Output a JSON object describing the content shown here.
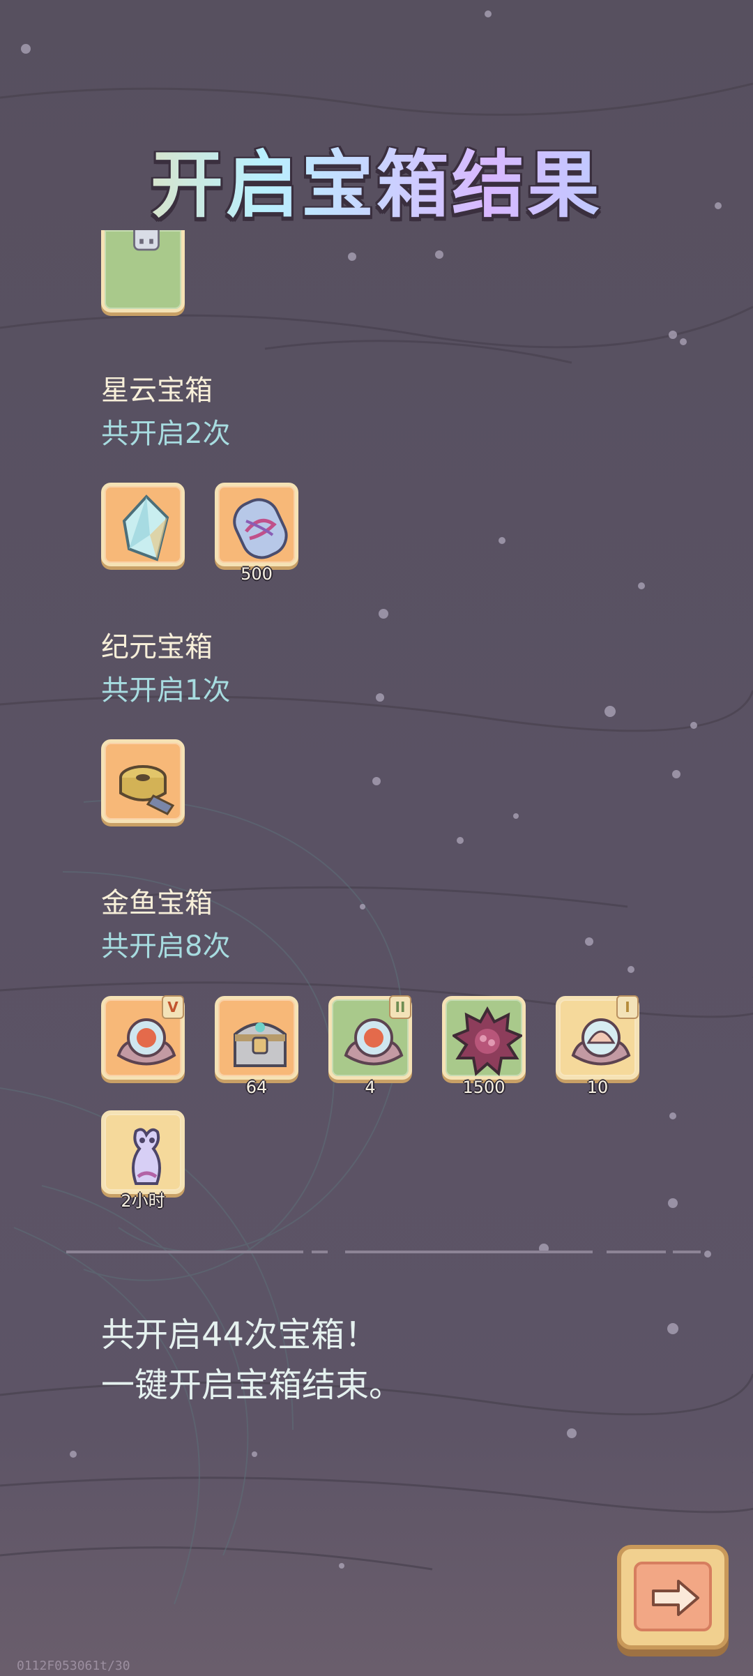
{
  "title": "开启宝箱结果",
  "sections": [
    {
      "name": "星云宝箱",
      "count": "共开启2次",
      "items": [
        {
          "icon": "crystal-shard-icon",
          "qty": "",
          "badge": ""
        },
        {
          "icon": "nebula-capsule-icon",
          "qty": "500",
          "badge": ""
        }
      ]
    },
    {
      "name": "纪元宝箱",
      "count": "共开启1次",
      "items": [
        {
          "icon": "film-reel-icon",
          "qty": "",
          "badge": ""
        }
      ]
    },
    {
      "name": "金鱼宝箱",
      "count": "共开启8次",
      "items": [
        {
          "icon": "pearl-orb-icon",
          "qty": "",
          "badge": "V"
        },
        {
          "icon": "treasure-chest-icon",
          "qty": "64",
          "badge": ""
        },
        {
          "icon": "pearl-orb-icon",
          "qty": "4",
          "badge": "II"
        },
        {
          "icon": "sea-urchin-icon",
          "qty": "1500",
          "badge": ""
        },
        {
          "icon": "shell-orb-icon",
          "qty": "10",
          "badge": "I"
        },
        {
          "icon": "ghost-creature-icon",
          "qty": "2小时",
          "badge": ""
        }
      ]
    }
  ],
  "summary": {
    "line1": "共开启44次宝箱！",
    "line2": "一键开启宝箱结束。"
  },
  "footer_code": "0112F053061t/30",
  "next_button": {
    "icon": "arrow-right-icon"
  }
}
